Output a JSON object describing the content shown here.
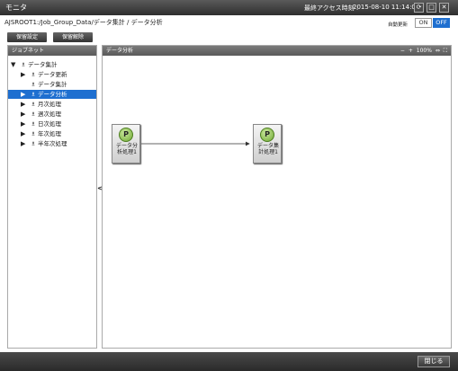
{
  "window": {
    "title": "モニタ",
    "last_access_label": "最終アクセス時刻 :",
    "last_access_time": "2015-08-10 11:14:02",
    "buttons": [
      "⟳",
      "□",
      "✕"
    ]
  },
  "path": {
    "text": "AJSROOT1:/Job_Group_Data/データ集計 / データ分析"
  },
  "auto_update": {
    "label": "自動更新",
    "on_label": "ON",
    "off_label": "OFF",
    "state": "OFF"
  },
  "toolbar": {
    "hold_set_label": "保留設定",
    "hold_release_label": "保留解除"
  },
  "left_panel": {
    "title": "ジョブネット",
    "tree": [
      {
        "label": "データ集計",
        "expanded": true,
        "level": 0,
        "has_arrow": true
      },
      {
        "label": "データ更新",
        "level": 1,
        "has_arrow": true
      },
      {
        "label": "データ集計",
        "level": 1,
        "has_arrow": false
      },
      {
        "label": "データ分析",
        "level": 1,
        "has_arrow": true,
        "selected": true
      },
      {
        "label": "月次処理",
        "level": 1,
        "has_arrow": true
      },
      {
        "label": "週次処理",
        "level": 1,
        "has_arrow": true
      },
      {
        "label": "日次処理",
        "level": 1,
        "has_arrow": true
      },
      {
        "label": "年次処理",
        "level": 1,
        "has_arrow": true
      },
      {
        "label": "半年次処理",
        "level": 1,
        "has_arrow": true
      }
    ]
  },
  "right_panel": {
    "title": "データ分析",
    "zoom_level": "100%",
    "zoom_out": "−",
    "zoom_in": "+",
    "fit": "⇔",
    "full": "⛶"
  },
  "nodes": [
    {
      "label": "データ分析処理1",
      "icon": "P"
    },
    {
      "label": "データ集計処理1",
      "icon": "P"
    }
  ],
  "footer": {
    "close_label": "閉じる"
  }
}
